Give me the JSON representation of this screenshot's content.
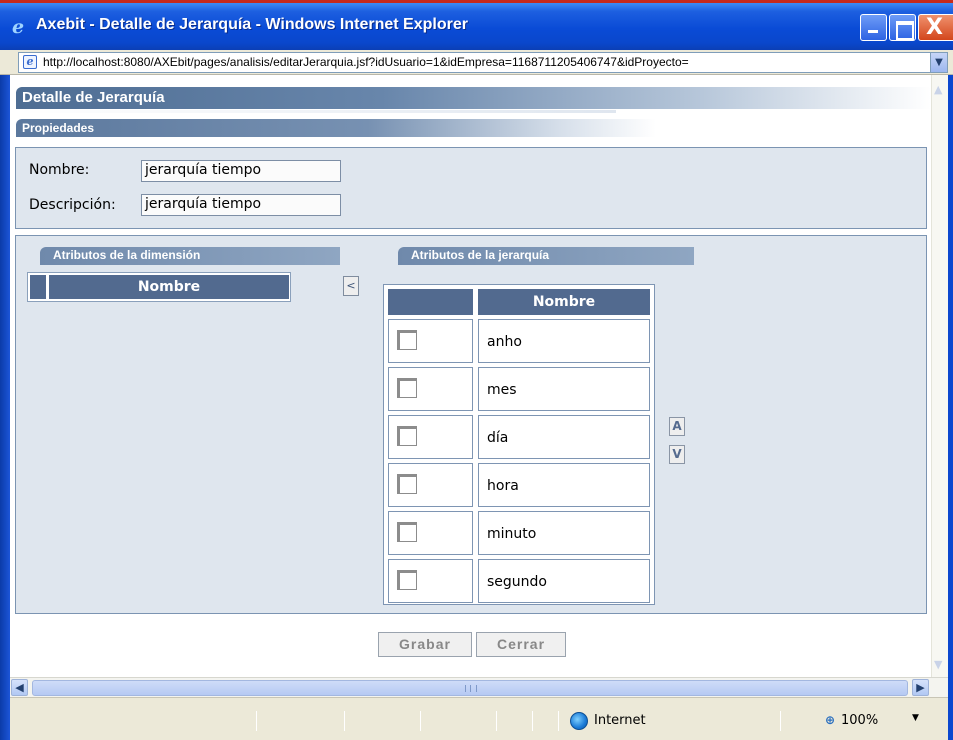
{
  "window": {
    "title": "Axebit - Detalle de Jerarquía - Windows Internet Explorer",
    "minimize_glyph": "",
    "maximize_glyph": "",
    "close_glyph": "X"
  },
  "address": {
    "url": "http://localhost:8080/AXEbit/pages/analisis/editarJerarquia.jsf?idUsuario=1&idEmpresa=1168711205406747&idProyecto="
  },
  "page": {
    "header_title": "Detalle de Jerarquía",
    "section_title": "Propiedades",
    "nombre_label": "Nombre:",
    "nombre_value": "jerarquía tiempo",
    "descripcion_label": "Descripción:",
    "descripcion_value": "jerarquía tiempo"
  },
  "dimension": {
    "title": "Atributos de la dimensión",
    "column_header": "Nombre",
    "rows": []
  },
  "hierarchy": {
    "title": "Atributos de la jerarquía",
    "column_header": "Nombre",
    "rows": [
      {
        "name": "anho",
        "checked": false
      },
      {
        "name": "mes",
        "checked": false
      },
      {
        "name": "día",
        "checked": false
      },
      {
        "name": "hora",
        "checked": false
      },
      {
        "name": "minuto",
        "checked": false
      },
      {
        "name": "segundo",
        "checked": false
      }
    ]
  },
  "controls": {
    "move_left": "<",
    "move_up": "A",
    "move_down": "V"
  },
  "actions": {
    "save": "Grabar",
    "close": "Cerrar"
  },
  "statusbar": {
    "zone": "Internet",
    "zoom": "100%",
    "zoom_dropdown_icon": "chevron-down-icon"
  },
  "colors": {
    "titlebar": "#0a4bd6",
    "panel_background": "#dfe6ee",
    "table_header": "#526a8f"
  }
}
